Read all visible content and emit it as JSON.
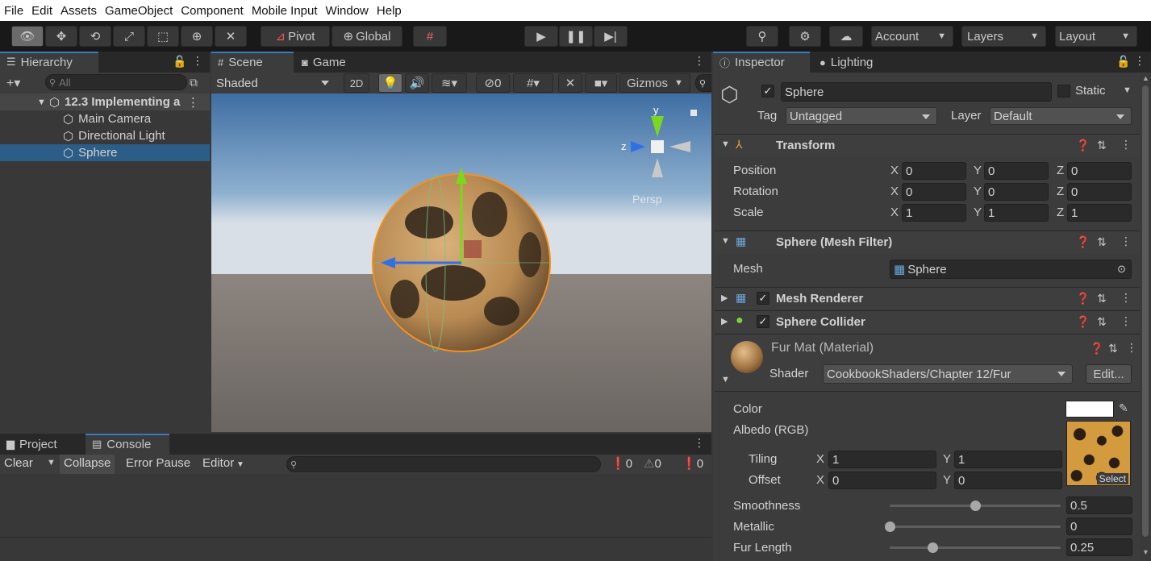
{
  "menu": [
    "File",
    "Edit",
    "Assets",
    "GameObject",
    "Component",
    "Mobile Input",
    "Window",
    "Help"
  ],
  "toolbar": {
    "pivot": "Pivot",
    "global": "Global",
    "account": "Account",
    "layers": "Layers",
    "layout": "Layout"
  },
  "hierarchy": {
    "tab": "Hierarchy",
    "search_placeholder": "All",
    "scene": "12.3 Implementing a",
    "items": [
      "Main Camera",
      "Directional Light",
      "Sphere"
    ]
  },
  "scene_view": {
    "tab_scene": "Scene",
    "tab_game": "Game",
    "shading": "Shaded",
    "mode_2d": "2D",
    "hidden_count": "0",
    "gizmos": "Gizmos",
    "gizmo_y": "y",
    "gizmo_z": "z",
    "persp": "Persp"
  },
  "bottom": {
    "tab_project": "Project",
    "tab_console": "Console",
    "clear": "Clear",
    "collapse": "Collapse",
    "error_pause": "Error Pause",
    "editor": "Editor",
    "log_count": "0",
    "warn_count": "0",
    "error_count": "0"
  },
  "inspector": {
    "tab_inspector": "Inspector",
    "tab_lighting": "Lighting",
    "object_name": "Sphere",
    "static_label": "Static",
    "tag_label": "Tag",
    "tag_value": "Untagged",
    "layer_label": "Layer",
    "layer_value": "Default",
    "transform": {
      "title": "Transform",
      "position_label": "Position",
      "rotation_label": "Rotation",
      "scale_label": "Scale",
      "x": "X",
      "y": "Y",
      "z": "Z",
      "position": [
        "0",
        "0",
        "0"
      ],
      "rotation": [
        "0",
        "0",
        "0"
      ],
      "scale": [
        "1",
        "1",
        "1"
      ]
    },
    "mesh_filter": {
      "title": "Sphere (Mesh Filter)",
      "mesh_label": "Mesh",
      "mesh_value": "Sphere"
    },
    "mesh_renderer": {
      "title": "Mesh Renderer"
    },
    "sphere_collider": {
      "title": "Sphere Collider"
    },
    "material": {
      "name": "Fur Mat (Material)",
      "shader_label": "Shader",
      "shader_value": "CookbookShaders/Chapter 12/Fur",
      "edit": "Edit...",
      "color_label": "Color",
      "albedo_label": "Albedo (RGB)",
      "tiling_label": "Tiling",
      "offset_label": "Offset",
      "tiling": [
        "1",
        "1"
      ],
      "offset": [
        "0",
        "0"
      ],
      "select": "Select",
      "smoothness_label": "Smoothness",
      "smoothness": 0.5,
      "smoothness_text": "0.5",
      "metallic_label": "Metallic",
      "metallic": 0,
      "metallic_text": "0",
      "fur_length_label": "Fur Length",
      "fur_length": 0.25,
      "fur_length_text": "0.25"
    }
  },
  "colors": {
    "accent": "#3a79bb",
    "selection_orange": "#f5901e",
    "bg": "#383838"
  }
}
